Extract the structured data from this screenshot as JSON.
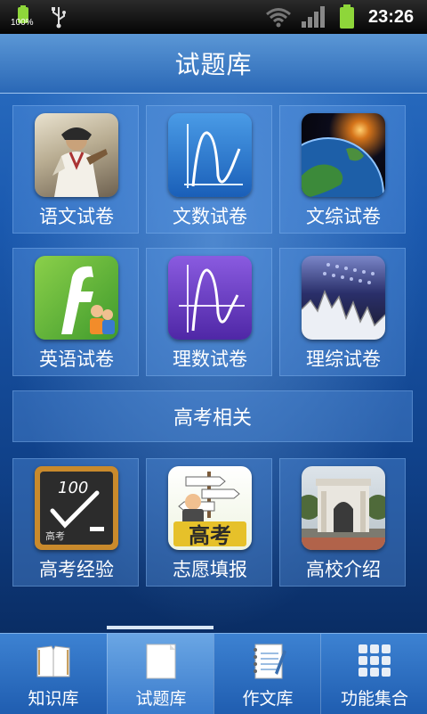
{
  "status_bar": {
    "battery_percent": "100%",
    "time": "23:26"
  },
  "header": {
    "title": "试题库"
  },
  "grid": {
    "tiles": [
      {
        "label": "语文试卷",
        "icon": "warrior-portrait-icon"
      },
      {
        "label": "文数试卷",
        "icon": "math-graph-icon"
      },
      {
        "label": "文综试卷",
        "icon": "earth-icon"
      },
      {
        "label": "英语试卷",
        "icon": "letter-f-icon"
      },
      {
        "label": "理数试卷",
        "icon": "math-graph-purple-icon"
      },
      {
        "label": "理综试卷",
        "icon": "science-chart-icon"
      }
    ]
  },
  "section": {
    "title": "高考相关"
  },
  "gaokao": {
    "tiles": [
      {
        "label": "高考经验",
        "icon": "blackboard-100-icon",
        "board_score": "100",
        "board_caption": "高考"
      },
      {
        "label": "志愿填报",
        "icon": "signpost-gaokao-icon",
        "sign_text": "高考"
      },
      {
        "label": "高校介绍",
        "icon": "university-gate-icon"
      }
    ]
  },
  "bottom_nav": {
    "items": [
      {
        "label": "知识库",
        "icon": "book-icon",
        "active": false
      },
      {
        "label": "试题库",
        "icon": "paper-icon",
        "active": true
      },
      {
        "label": "作文库",
        "icon": "notebook-icon",
        "active": false
      },
      {
        "label": "功能集合",
        "icon": "grid-icon",
        "active": false
      }
    ]
  },
  "colors": {
    "accent": "#2b6fc2",
    "battery": "#8ed63a"
  }
}
